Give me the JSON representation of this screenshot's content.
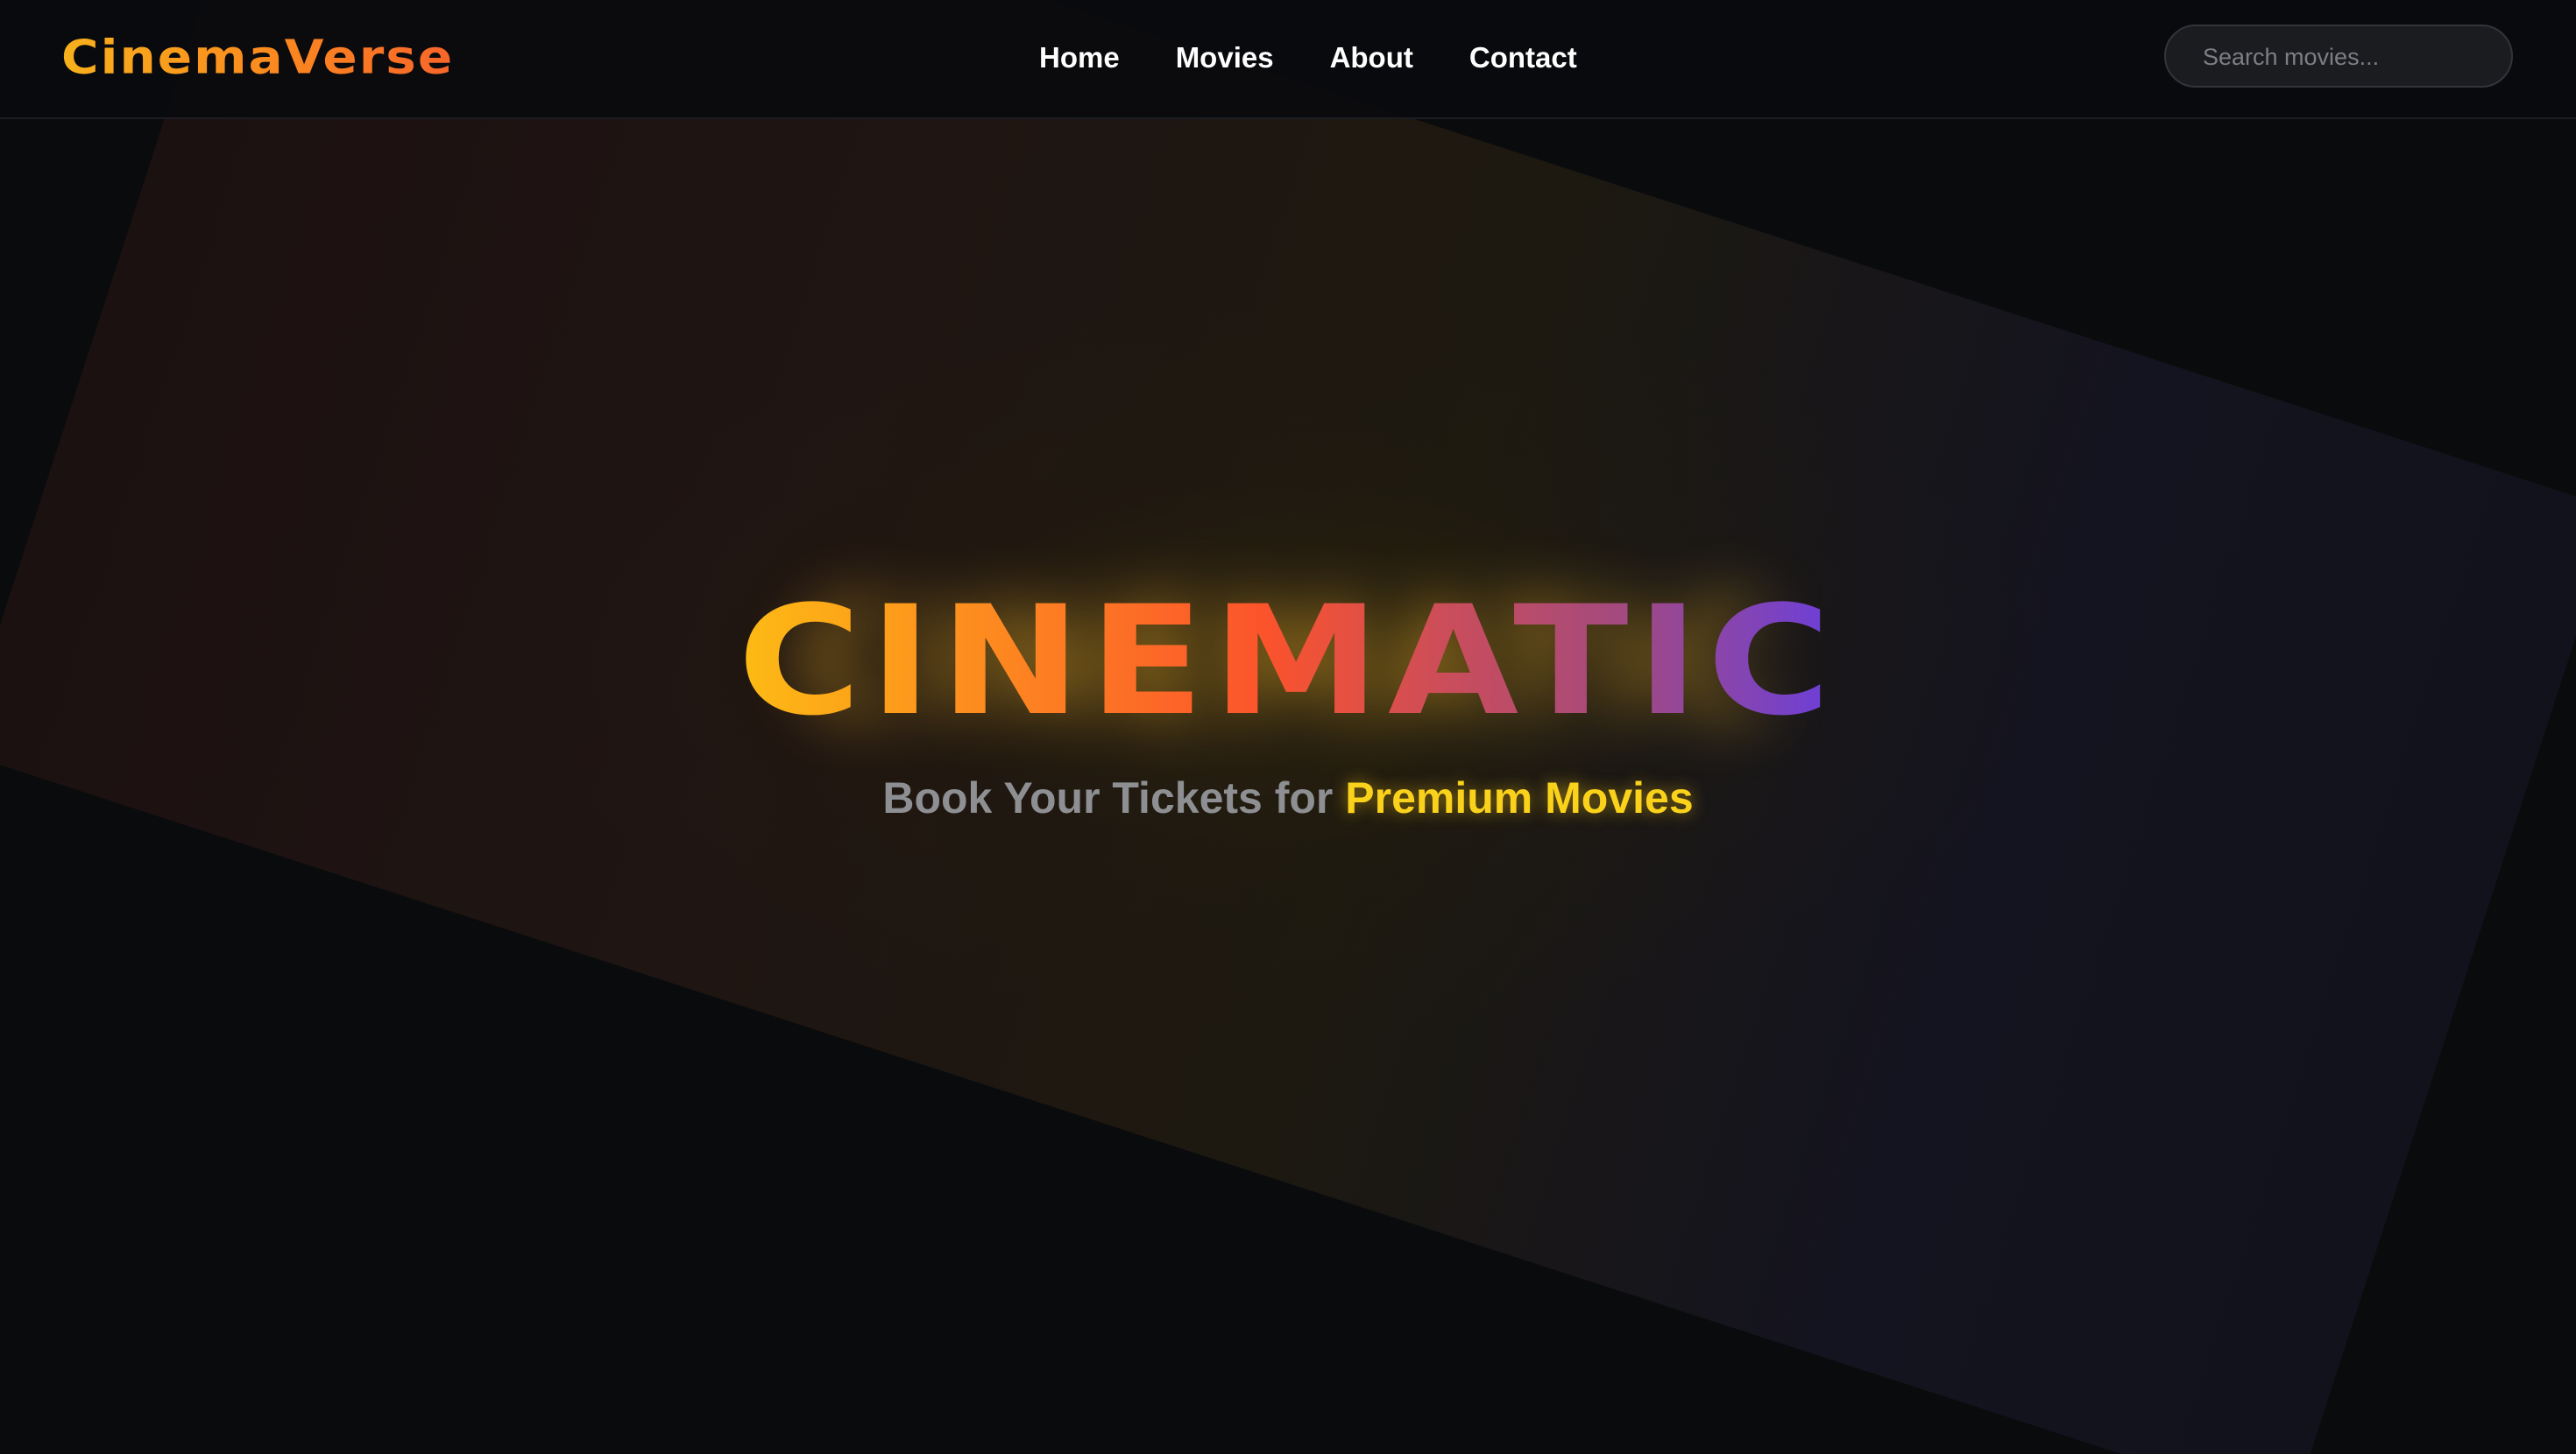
{
  "header": {
    "logo_text": "CinemaVerse",
    "nav": [
      {
        "label": "Home"
      },
      {
        "label": "Movies"
      },
      {
        "label": "About"
      },
      {
        "label": "Contact"
      }
    ],
    "search_placeholder": "Search movies..."
  },
  "hero": {
    "title": "CINEMATIC",
    "subtitle_prefix": "Book Your Tickets for ",
    "subtitle_highlight": "Premium Movies"
  },
  "colors": {
    "background": "#0a0b0d",
    "logo_gradient_start": "#f7b11c",
    "logo_gradient_end": "#f8652a",
    "title_gradient_start": "#fdbb14",
    "title_gradient_mid": "#fb532c",
    "title_gradient_end": "#6b3fdc",
    "highlight": "#fbd21b",
    "subtitle": "#8e8f93"
  }
}
